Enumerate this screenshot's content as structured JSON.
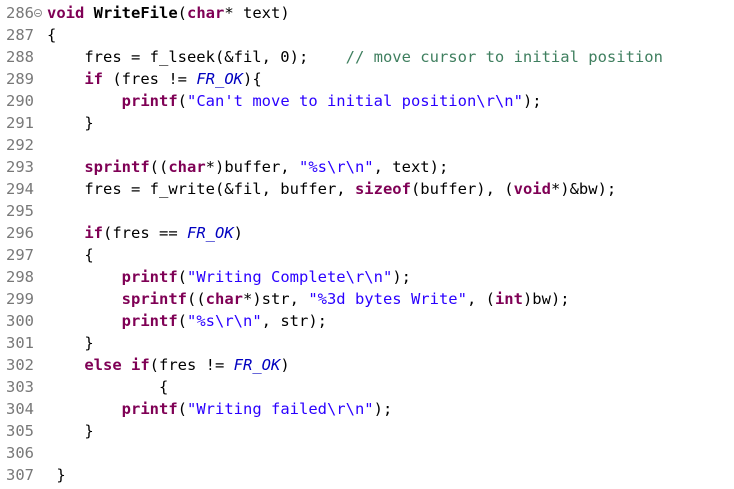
{
  "editor": {
    "lines": [
      {
        "num": "286",
        "fold": true,
        "tokens": [
          {
            "t": "kw",
            "v": "void"
          },
          {
            "t": "p",
            "v": " "
          },
          {
            "t": "fn",
            "v": "WriteFile"
          },
          {
            "t": "p",
            "v": "("
          },
          {
            "t": "kw",
            "v": "char"
          },
          {
            "t": "p",
            "v": "* text)"
          }
        ]
      },
      {
        "num": "287",
        "tokens": [
          {
            "t": "p",
            "v": "{"
          }
        ]
      },
      {
        "num": "288",
        "tokens": [
          {
            "t": "p",
            "v": "    fres = f_lseek(&fil, 0);    "
          },
          {
            "t": "cmt",
            "v": "// move cursor to initial position"
          }
        ]
      },
      {
        "num": "289",
        "tokens": [
          {
            "t": "p",
            "v": "    "
          },
          {
            "t": "kw",
            "v": "if"
          },
          {
            "t": "p",
            "v": " (fres != "
          },
          {
            "t": "mac",
            "v": "FR_OK"
          },
          {
            "t": "p",
            "v": "){"
          }
        ]
      },
      {
        "num": "290",
        "tokens": [
          {
            "t": "p",
            "v": "        "
          },
          {
            "t": "kw",
            "v": "printf"
          },
          {
            "t": "p",
            "v": "("
          },
          {
            "t": "str",
            "v": "\"Can't move to initial position\\r\\n\""
          },
          {
            "t": "p",
            "v": ");"
          }
        ]
      },
      {
        "num": "291",
        "tokens": [
          {
            "t": "p",
            "v": "    }"
          }
        ]
      },
      {
        "num": "292",
        "tokens": []
      },
      {
        "num": "293",
        "tokens": [
          {
            "t": "p",
            "v": "    "
          },
          {
            "t": "kw",
            "v": "sprintf"
          },
          {
            "t": "p",
            "v": "(("
          },
          {
            "t": "kw",
            "v": "char"
          },
          {
            "t": "p",
            "v": "*)buffer, "
          },
          {
            "t": "str",
            "v": "\"%s\\r\\n\""
          },
          {
            "t": "p",
            "v": ", text);"
          }
        ]
      },
      {
        "num": "294",
        "tokens": [
          {
            "t": "p",
            "v": "    fres = f_write(&fil, buffer, "
          },
          {
            "t": "kw",
            "v": "sizeof"
          },
          {
            "t": "p",
            "v": "(buffer), ("
          },
          {
            "t": "kw",
            "v": "void"
          },
          {
            "t": "p",
            "v": "*)&bw);"
          }
        ]
      },
      {
        "num": "295",
        "tokens": []
      },
      {
        "num": "296",
        "tokens": [
          {
            "t": "p",
            "v": "    "
          },
          {
            "t": "kw",
            "v": "if"
          },
          {
            "t": "p",
            "v": "(fres == "
          },
          {
            "t": "mac",
            "v": "FR_OK"
          },
          {
            "t": "p",
            "v": ")"
          }
        ]
      },
      {
        "num": "297",
        "tokens": [
          {
            "t": "p",
            "v": "    {"
          }
        ]
      },
      {
        "num": "298",
        "tokens": [
          {
            "t": "p",
            "v": "        "
          },
          {
            "t": "kw",
            "v": "printf"
          },
          {
            "t": "p",
            "v": "("
          },
          {
            "t": "str",
            "v": "\"Writing Complete\\r\\n\""
          },
          {
            "t": "p",
            "v": ");"
          }
        ]
      },
      {
        "num": "299",
        "tokens": [
          {
            "t": "p",
            "v": "        "
          },
          {
            "t": "kw",
            "v": "sprintf"
          },
          {
            "t": "p",
            "v": "(("
          },
          {
            "t": "kw",
            "v": "char"
          },
          {
            "t": "p",
            "v": "*)str, "
          },
          {
            "t": "str",
            "v": "\"%3d bytes Write\""
          },
          {
            "t": "p",
            "v": ", ("
          },
          {
            "t": "kw",
            "v": "int"
          },
          {
            "t": "p",
            "v": ")bw);"
          }
        ]
      },
      {
        "num": "300",
        "tokens": [
          {
            "t": "p",
            "v": "        "
          },
          {
            "t": "kw",
            "v": "printf"
          },
          {
            "t": "p",
            "v": "("
          },
          {
            "t": "str",
            "v": "\"%s\\r\\n\""
          },
          {
            "t": "p",
            "v": ", str);"
          }
        ]
      },
      {
        "num": "301",
        "tokens": [
          {
            "t": "p",
            "v": "    }"
          }
        ]
      },
      {
        "num": "302",
        "tokens": [
          {
            "t": "p",
            "v": "    "
          },
          {
            "t": "kw",
            "v": "else"
          },
          {
            "t": "p",
            "v": " "
          },
          {
            "t": "kw",
            "v": "if"
          },
          {
            "t": "p",
            "v": "(fres != "
          },
          {
            "t": "mac",
            "v": "FR_OK"
          },
          {
            "t": "p",
            "v": ")"
          }
        ]
      },
      {
        "num": "303",
        "tokens": [
          {
            "t": "p",
            "v": "            {"
          }
        ]
      },
      {
        "num": "304",
        "tokens": [
          {
            "t": "p",
            "v": "        "
          },
          {
            "t": "kw",
            "v": "printf"
          },
          {
            "t": "p",
            "v": "("
          },
          {
            "t": "str",
            "v": "\"Writing failed\\r\\n\""
          },
          {
            "t": "p",
            "v": ");"
          }
        ]
      },
      {
        "num": "305",
        "tokens": [
          {
            "t": "p",
            "v": "    }"
          }
        ]
      },
      {
        "num": "306",
        "tokens": []
      },
      {
        "num": "307",
        "tokens": [
          {
            "t": "p",
            "v": " }"
          }
        ]
      }
    ]
  },
  "colors": {
    "background": "#ffffff",
    "line_number": "#787878",
    "keyword": "#7f0055",
    "string": "#2a00ff",
    "comment": "#3f7f5f",
    "macro": "#0000c0",
    "plain": "#000000"
  }
}
